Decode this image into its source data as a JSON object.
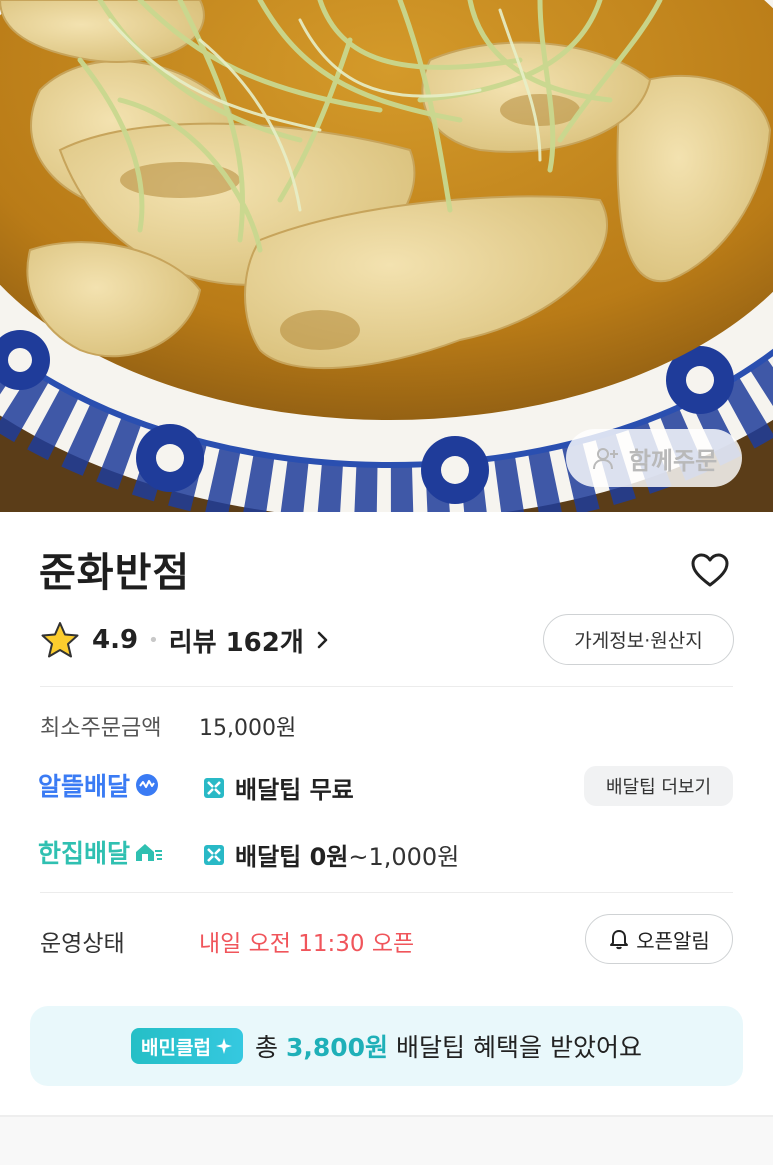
{
  "hero": {
    "together_order_label": "함께주문"
  },
  "store": {
    "name": "준화반점",
    "rating": "4.9",
    "review_label": "리뷰 162개",
    "info_button": "가게정보·원산지"
  },
  "delivery": {
    "min_order_label": "최소주문금액",
    "min_order_value": "15,000원",
    "alttl_brand": "알뜰배달",
    "alttl_tip_label": "배달팁 무료",
    "more_tip_button": "배달팁 더보기",
    "hanjip_brand": "한집배달",
    "hanjip_tip_bold": "배달팁 0원",
    "hanjip_tip_tail": "~1,000원"
  },
  "status": {
    "label": "운영상태",
    "value": "내일 오전 11:30 오픈",
    "alarm_button": "오픈알림"
  },
  "club": {
    "chip_label": "배민클럽",
    "prefix": "총",
    "amount": "3,800원",
    "suffix": "배달팁 혜택을 받았어요"
  },
  "colors": {
    "alttl_blue": "#3a7bf4",
    "hanjip_teal": "#2fc0b1",
    "status_red": "#f0555b",
    "club_teal": "#1fb0b8"
  }
}
